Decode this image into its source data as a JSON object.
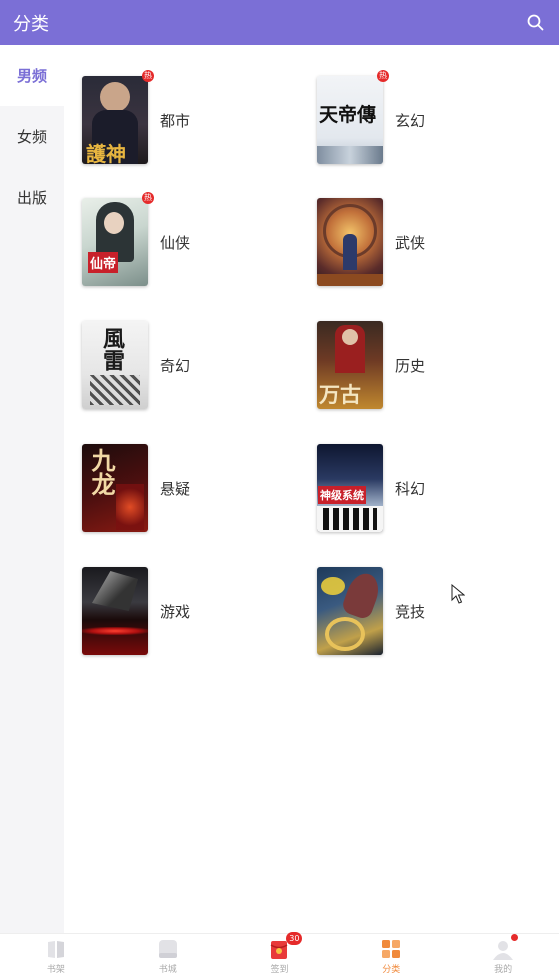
{
  "header": {
    "title": "分类",
    "search_icon": "search-icon"
  },
  "sidebar": {
    "items": [
      {
        "label": "男频",
        "active": true
      },
      {
        "label": "女频",
        "active": false
      },
      {
        "label": "出版",
        "active": false
      }
    ]
  },
  "categories": [
    {
      "label": "都市",
      "hot": true,
      "hot_label": "热",
      "cover_text": "護神"
    },
    {
      "label": "玄幻",
      "hot": true,
      "hot_label": "热",
      "cover_text": "天帝傳"
    },
    {
      "label": "仙侠",
      "hot": true,
      "hot_label": "热",
      "cover_text": "仙帝"
    },
    {
      "label": "武侠",
      "hot": false,
      "hot_label": "",
      "cover_text": ""
    },
    {
      "label": "奇幻",
      "hot": false,
      "hot_label": "",
      "cover_text": "風雷"
    },
    {
      "label": "历史",
      "hot": false,
      "hot_label": "",
      "cover_text": "万古"
    },
    {
      "label": "悬疑",
      "hot": false,
      "hot_label": "",
      "cover_text": "九龙"
    },
    {
      "label": "科幻",
      "hot": false,
      "hot_label": "",
      "cover_text": "神级系统"
    },
    {
      "label": "游戏",
      "hot": false,
      "hot_label": "",
      "cover_text": ""
    },
    {
      "label": "竞技",
      "hot": false,
      "hot_label": "",
      "cover_text": ""
    }
  ],
  "tabbar": {
    "items": [
      {
        "label": "书架",
        "icon": "book-icon",
        "active": false
      },
      {
        "label": "书城",
        "icon": "store-icon",
        "active": false
      },
      {
        "label": "签到",
        "icon": "red-envelope-icon",
        "active": false,
        "badge": "30"
      },
      {
        "label": "分类",
        "icon": "grid-icon",
        "active": true
      },
      {
        "label": "我的",
        "icon": "user-icon",
        "active": false,
        "dot": true
      }
    ]
  },
  "colors": {
    "primary": "#7b6fd6",
    "active_tab": "#f08a3c",
    "hot": "#e52a2a"
  }
}
